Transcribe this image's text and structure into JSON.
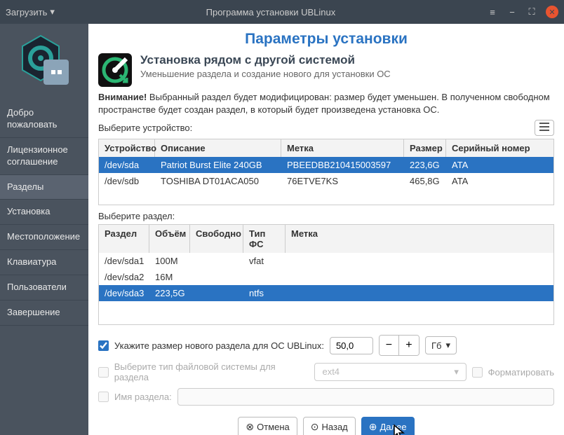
{
  "titlebar": {
    "load": "Загрузить",
    "title": "Программа установки UBLinux"
  },
  "sidebar": {
    "items": [
      {
        "label": "Добро пожаловать"
      },
      {
        "label": "Лицензионное соглашение"
      },
      {
        "label": "Разделы"
      },
      {
        "label": "Установка"
      },
      {
        "label": "Местоположение"
      },
      {
        "label": "Клавиатура"
      },
      {
        "label": "Пользователи"
      },
      {
        "label": "Завершение"
      }
    ],
    "active": 2
  },
  "page": {
    "title": "Параметры установки",
    "subtitle": "Установка рядом с другой системой",
    "subdesc": "Уменьшение раздела и создание нового для установки ОС",
    "warning_label": "Внимание!",
    "warning_text": " Выбранный раздел будет модифицирован: размер будет уменьшен. В полученном свободном пространстве будет создан раздел, в который будет произведена установка ОС.",
    "select_device": "Выберите устройство:",
    "select_partition": "Выберите раздел:"
  },
  "dev_table": {
    "headers": [
      "Устройство",
      "Описание",
      "Метка",
      "Размер",
      "Серийный номер"
    ],
    "rows": [
      {
        "cells": [
          "/dev/sda",
          "Patriot Burst Elite 240GB",
          "PBEEDBB210415003597",
          "223,6G",
          "ATA"
        ],
        "selected": true
      },
      {
        "cells": [
          "/dev/sdb",
          "TOSHIBA DT01ACA050",
          "76ETVE7KS",
          "465,8G",
          "ATA"
        ],
        "selected": false
      }
    ]
  },
  "part_table": {
    "headers": [
      "Раздел",
      "Объём",
      "Свободно",
      "Тип ФС",
      "Метка"
    ],
    "rows": [
      {
        "cells": [
          "/dev/sda1",
          "100M",
          "",
          "vfat",
          ""
        ],
        "selected": false
      },
      {
        "cells": [
          "/dev/sda2",
          "16M",
          "",
          "",
          ""
        ],
        "selected": false
      },
      {
        "cells": [
          "/dev/sda3",
          "223,5G",
          "",
          "ntfs",
          ""
        ],
        "selected": true
      }
    ]
  },
  "options": {
    "size_label": "Укажите размер нового раздела для ОС UBLinux:",
    "size_value": "50,0",
    "size_unit": "Гб",
    "fs_label": "Выберите тип файловой системы для раздела",
    "fs_value": "ext4",
    "format_label": "Форматировать",
    "name_label": "Имя раздела:",
    "name_value": ""
  },
  "footer": {
    "cancel": "Отмена",
    "back": "Назад",
    "next": "Далее"
  }
}
